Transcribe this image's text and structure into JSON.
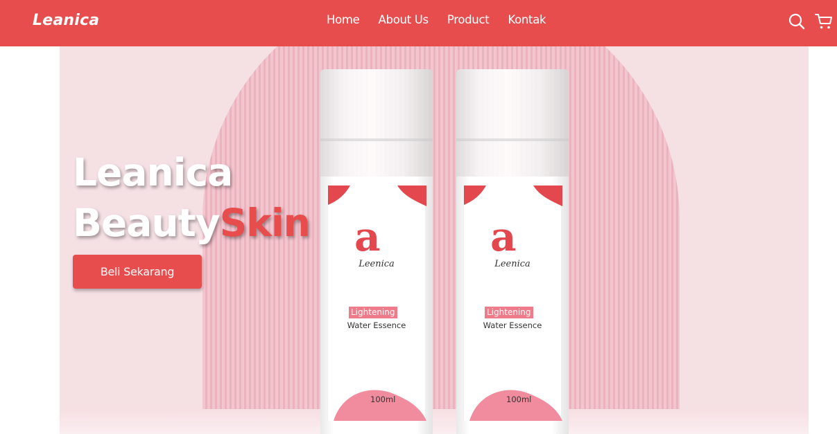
{
  "nav": {
    "brand": "Leanica",
    "links": [
      "Home",
      "About Us",
      "Product",
      "Kontak"
    ],
    "icons": [
      "search-icon",
      "cart-icon"
    ]
  },
  "hero": {
    "title_line1": "Leanica",
    "title_line2a": "Beauty",
    "title_line2b": "Skin",
    "cta_label": "Beli Sekarang"
  },
  "product": {
    "brand": "Leenica",
    "tag": "Lightening",
    "name": "Water Essence",
    "volume": "100ml"
  },
  "colors": {
    "primary": "#e84d4e",
    "hero_bg": "#f5e0e4",
    "arch": "#f0c0c9"
  }
}
